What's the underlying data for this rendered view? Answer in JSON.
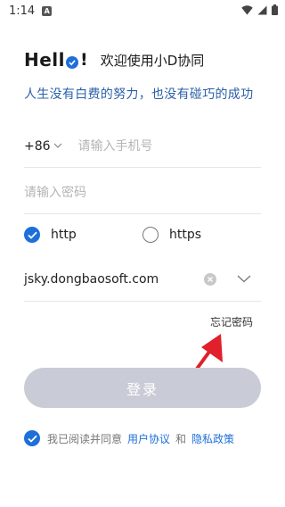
{
  "status_bar": {
    "time": "1:14",
    "notification_badge": "A"
  },
  "greeting": {
    "hello": "Hell",
    "exclaim": "!",
    "title": "欢迎使用小D协同"
  },
  "slogan": "人生没有白费的努力，也没有碰巧的成功",
  "login_form": {
    "country_code": "+86",
    "phone_placeholder": "请输入手机号",
    "password_placeholder": "请输入密码",
    "protocol_http": "http",
    "protocol_https": "https",
    "selected_protocol": "http",
    "server_address": "jsky.dongbaosoft.com",
    "forgot_password": "忘记密码",
    "login_button": "登录"
  },
  "agreement": {
    "checked": true,
    "prefix": "我已阅读并同意",
    "user_agreement": "用户协议",
    "and": "和",
    "privacy_policy": "隐私政策"
  },
  "colors": {
    "accent": "#1e6fd9",
    "slogan": "#2a5fa8",
    "login_button_disabled": "#c9ccd6",
    "annotation_arrow": "#e0202a"
  },
  "icons": [
    "wifi-icon",
    "cellular-signal-icon",
    "battery-icon",
    "chevron-down-icon",
    "check-icon",
    "clear-icon",
    "arrow-annotation-icon"
  ]
}
